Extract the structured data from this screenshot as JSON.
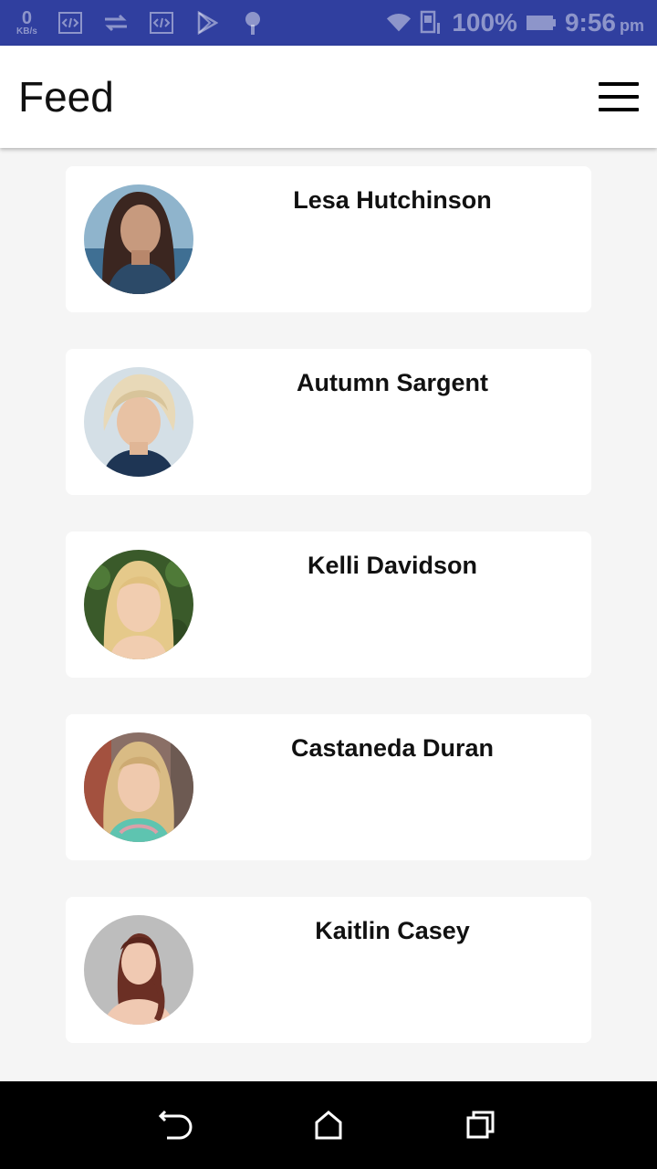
{
  "status_bar": {
    "net_speed_value": "0",
    "net_speed_unit": "KB/s",
    "battery": "100%",
    "time": "9:56",
    "ampm": "pm",
    "icons": [
      "code-icon",
      "data-transfer-icon",
      "code-icon",
      "play-store-icon",
      "location-icon",
      "wifi-icon",
      "sim-icon",
      "battery-icon"
    ]
  },
  "app_bar": {
    "title": "Feed",
    "menu_icon": "hamburger-menu-icon"
  },
  "feed": {
    "items": [
      {
        "name": "Lesa Hutchinson",
        "avatar": "avatar-photo"
      },
      {
        "name": "Autumn Sargent",
        "avatar": "avatar-photo"
      },
      {
        "name": "Kelli Davidson",
        "avatar": "avatar-photo"
      },
      {
        "name": "Castaneda Duran",
        "avatar": "avatar-photo"
      },
      {
        "name": "Kaitlin Casey",
        "avatar": "avatar-photo"
      }
    ]
  },
  "nav_bar": {
    "icons": [
      "back-icon",
      "home-icon",
      "recents-icon"
    ]
  },
  "colors": {
    "status_bar_bg": "#303f9f",
    "app_bar_bg": "#ffffff",
    "feed_bg": "#f5f5f5",
    "card_bg": "#ffffff",
    "nav_bar_bg": "#000000"
  }
}
